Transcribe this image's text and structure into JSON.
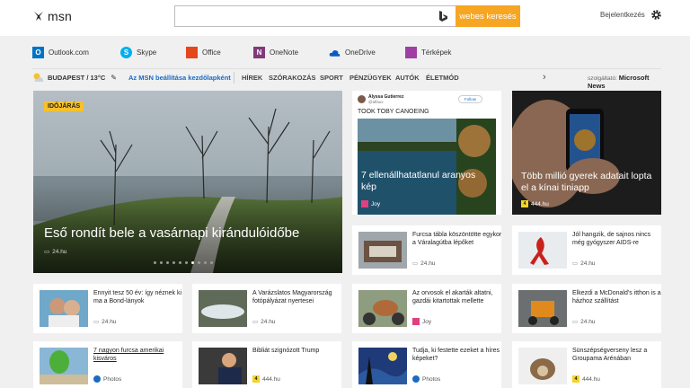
{
  "header": {
    "logo_text": "msn",
    "search_placeholder": "",
    "search_button": "webes keresés",
    "signin": "Bejelentkezés"
  },
  "quicklinks": [
    {
      "label": "Outlook.com",
      "icon": "outlook-icon",
      "color": "#0072c6"
    },
    {
      "label": "Skype",
      "icon": "skype-icon",
      "color": "#00aff0"
    },
    {
      "label": "Office",
      "icon": "office-icon",
      "color": "#e3471b"
    },
    {
      "label": "OneNote",
      "icon": "onenote-icon",
      "color": "#80397b"
    },
    {
      "label": "OneDrive",
      "icon": "onedrive-icon",
      "color": "#0a5bc4"
    },
    {
      "label": "Térképek",
      "icon": "maps-icon",
      "color": "#9f3fa3"
    }
  ],
  "nav": {
    "weather": "BUDAPEST / 13°C",
    "set_start": "Az MSN beállítása kezdőlapként",
    "items": [
      "HÍREK",
      "SZÓRAKOZÁS",
      "SPORT",
      "PÉNZÜGYEK",
      "AUTÓK",
      "ÉLETMÓD"
    ],
    "provider_label": "szolgáltató:",
    "provider": "Microsoft News"
  },
  "hero": {
    "badge": "IDŐJÁRÁS",
    "title": "Eső rondít bele a vasárnapi kirándulóidőbe",
    "source": "24.hu",
    "dots": 10,
    "active_dot": 6
  },
  "tweet_card": {
    "author": "Alyssa Gutierrez",
    "handle": "@alfaux",
    "follow": "Follow",
    "tweet_text": "TOOK TOBY CANOEING",
    "title": "7 ellenállhatatlanul aranyos kép",
    "source": "Joy"
  },
  "kid_card": {
    "title": "Több millió gyerek adatait lopta el a kínai tiniapp",
    "source": "444.hu"
  },
  "row1": [
    {
      "title": "Furcsa tábla köszöntötte egykor a Váralagútba lépőket",
      "source": "24.hu"
    },
    {
      "title": "Jól hangzik, de sajnos nincs még gyógyszer AIDS-re",
      "source": "24.hu"
    }
  ],
  "row2": [
    {
      "title": "Ennyit tesz 50 év: így néznek ki ma a Bond-lányok",
      "source": "24.hu"
    },
    {
      "title": "A Varázslatos Magyarország fotópályázat nyertesei",
      "source": "24.hu"
    },
    {
      "title": "Az orvosok el akarták altatni, gazdái kitartottak mellette",
      "source": "Joy"
    },
    {
      "title": "Elkezdi a McDonald's itthon is a házhoz szállítást",
      "source": "24.hu"
    }
  ],
  "row3": [
    {
      "title": "7 nagyon furcsa amerikai kisváros",
      "source": "Photos"
    },
    {
      "title": "Bibliát szignózott Trump",
      "source": "444.hu"
    },
    {
      "title": "Tudja, ki festette ezeket a híres képeket?",
      "source": "Photos"
    },
    {
      "title": "Sünszépségverseny lesz a Groupama Arénában",
      "source": "444.hu"
    }
  ]
}
